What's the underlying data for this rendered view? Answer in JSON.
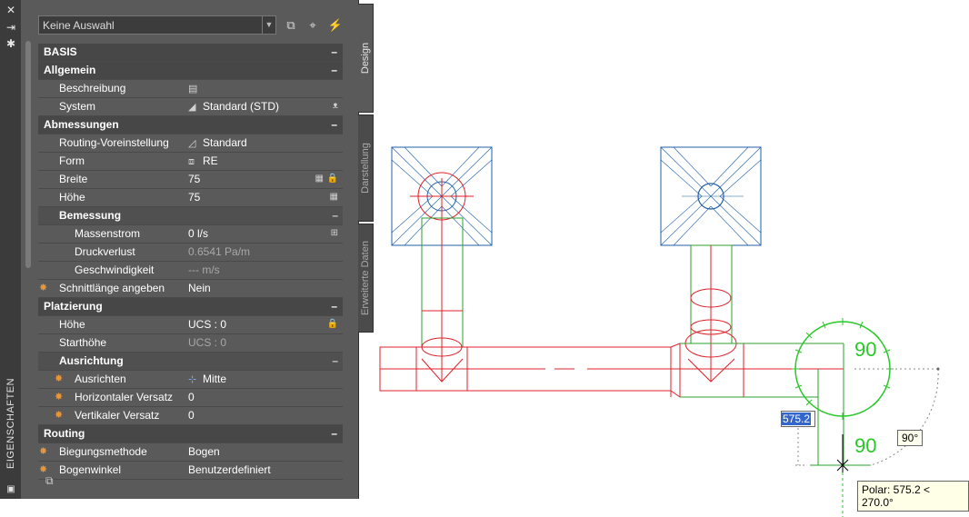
{
  "palette": {
    "title": "EIGENSCHAFTEN",
    "selection": "Keine Auswahl",
    "tabs": [
      {
        "label": "Design",
        "active": true
      },
      {
        "label": "Darstellung",
        "active": false
      },
      {
        "label": "Erweiterte Daten",
        "active": false
      }
    ],
    "icons": {
      "close": "close-icon",
      "autohide": "autohide-icon",
      "properties": "gear-icon",
      "add_selection": "add-selection-icon",
      "select_objects": "select-objects-icon",
      "quick_select": "quick-select-icon"
    },
    "sections": {
      "basis": "BASIS",
      "allgemein": "Allgemein",
      "abmessungen": "Abmessungen",
      "bemessung": "Bemessung",
      "platzierung": "Platzierung",
      "ausrichtung": "Ausrichtung",
      "routing": "Routing"
    },
    "collapse_symbol": "–",
    "props": {
      "beschreibung": {
        "label": "Beschreibung",
        "value": ""
      },
      "system": {
        "label": "System",
        "value": "Standard (STD)"
      },
      "routing_voreinstellung": {
        "label": "Routing-Voreinstellung",
        "value": "Standard"
      },
      "form": {
        "label": "Form",
        "value": "RE"
      },
      "breite": {
        "label": "Breite",
        "value": "75"
      },
      "hoehe": {
        "label": "Höhe",
        "value": "75"
      },
      "massenstrom": {
        "label": "Massenstrom",
        "value": "0 l/s"
      },
      "druckverlust": {
        "label": "Druckverlust",
        "value": "0.6541 Pa/m"
      },
      "geschwindigkeit": {
        "label": "Geschwindigkeit",
        "value": "--- m/s"
      },
      "schnittlaenge": {
        "label": "Schnittlänge angeben",
        "value": "Nein"
      },
      "p_hoehe": {
        "label": "Höhe",
        "value": "UCS : 0"
      },
      "starthoehe": {
        "label": "Starthöhe",
        "value": "UCS : 0"
      },
      "ausrichten": {
        "label": "Ausrichten",
        "value": "Mitte"
      },
      "h_versatz": {
        "label": "Horizontaler Versatz",
        "value": "0"
      },
      "v_versatz": {
        "label": "Vertikaler Versatz",
        "value": "0"
      },
      "biegungsmethode": {
        "label": "Biegungsmethode",
        "value": "Bogen"
      },
      "bogenwinkel": {
        "label": "Bogenwinkel",
        "value": "Benutzerdefiniert"
      }
    }
  },
  "drawing": {
    "dynamic_input_value": "575.2",
    "angle_readout": "90°",
    "tooltip": "Polar: 575.2 < 270.0°",
    "dimension_text_top": "90",
    "dimension_text_bottom": "90",
    "colors": {
      "duct": "#e0202a",
      "outline": "#2ca02c",
      "diffuser": "#1f5fa8",
      "track": "#28c828",
      "selection": "#3366cc"
    }
  }
}
